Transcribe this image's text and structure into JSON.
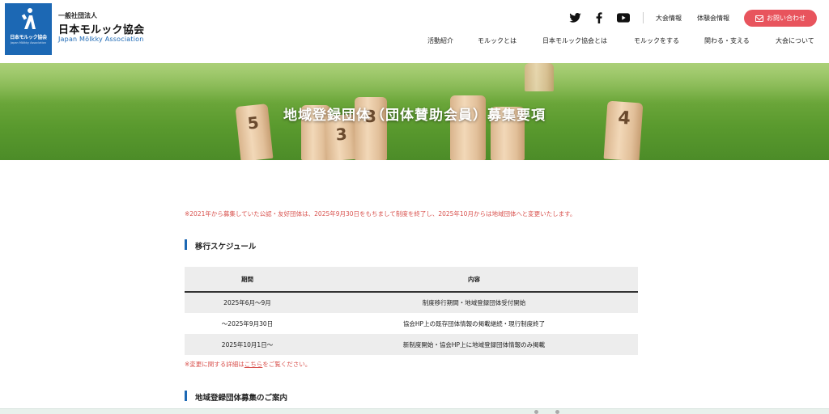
{
  "header": {
    "org_small": "一般社団法人",
    "org_name": "日本モルック協会",
    "org_en": "Japan Mölkky Association",
    "logo_text_jp": "日本モルック協会",
    "logo_text_en": "Japan Mölkky Association",
    "social": [
      "twitter-icon",
      "facebook-icon",
      "youtube-icon"
    ],
    "top_links": [
      "大会情報",
      "体験会情報"
    ],
    "contact_label": "お問い合わせ",
    "nav": [
      "活動紹介",
      "モルックとは",
      "日本モルック協会とは",
      "モルックをする",
      "関わる・支える",
      "大会について"
    ]
  },
  "hero": {
    "title": "地域登録団体（団体賛助会員）募集要項",
    "pins": [
      "5",
      "3",
      "3",
      "4"
    ]
  },
  "content": {
    "notice": "※2021年から募集していた公認・友好団体は、2025年9月30日をもちまして制度を終了し、2025年10月からは地域団体へと変更いたします。",
    "schedule_title": "移行スケジュール",
    "schedule": {
      "headers": [
        "期間",
        "内容"
      ],
      "rows": [
        [
          "2025年6月〜9月",
          "制度移行期間・地域登録団体受付開始"
        ],
        [
          "〜2025年9月30日",
          "協会HP上の既存団体情報の掲載継続・現行制度終了"
        ],
        [
          "2025年10月1日〜",
          "新制度開始・協会HP上に地域登録団体情報のみ掲載"
        ]
      ]
    },
    "note_prefix": "※変更に関する詳細は",
    "note_link": "こちら",
    "note_suffix": "をご覧ください。",
    "recruit_title": "地域登録団体募集のご案内"
  },
  "colors": {
    "brand_blue": "#1c68b4",
    "accent_red": "#e8545d",
    "notice_red": "#d9534f"
  }
}
